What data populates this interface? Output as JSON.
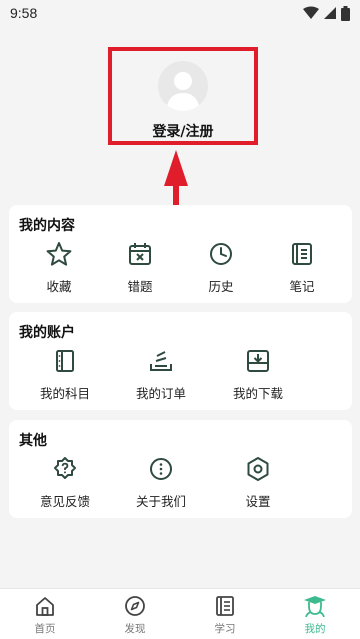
{
  "status_bar": {
    "time": "9:58"
  },
  "profile": {
    "login_label": "登录/注册"
  },
  "sections": [
    {
      "title": "我的内容",
      "items": [
        {
          "label": "收藏",
          "icon": "star-icon"
        },
        {
          "label": "错题",
          "icon": "calendar-x-icon"
        },
        {
          "label": "历史",
          "icon": "clock-icon"
        },
        {
          "label": "笔记",
          "icon": "notes-icon"
        }
      ]
    },
    {
      "title": "我的账户",
      "items": [
        {
          "label": "我的科目",
          "icon": "book-icon"
        },
        {
          "label": "我的订单",
          "icon": "order-icon"
        },
        {
          "label": "我的下载",
          "icon": "download-icon"
        }
      ]
    },
    {
      "title": "其他",
      "items": [
        {
          "label": "意见反馈",
          "icon": "feedback-icon"
        },
        {
          "label": "关于我们",
          "icon": "more-icon"
        },
        {
          "label": "设置",
          "icon": "settings-icon"
        }
      ]
    }
  ],
  "tabbar": {
    "active": "我的",
    "tabs": [
      {
        "label": "首页",
        "icon": "home-icon"
      },
      {
        "label": "发现",
        "icon": "compass-icon"
      },
      {
        "label": "学习",
        "icon": "study-icon"
      },
      {
        "label": "我的",
        "icon": "profile-icon"
      }
    ]
  },
  "colors": {
    "accent": "#3dbb8f",
    "icon": "#2f4a3f",
    "highlight_box": "#e01e2b",
    "background": "#f4f4f4"
  }
}
